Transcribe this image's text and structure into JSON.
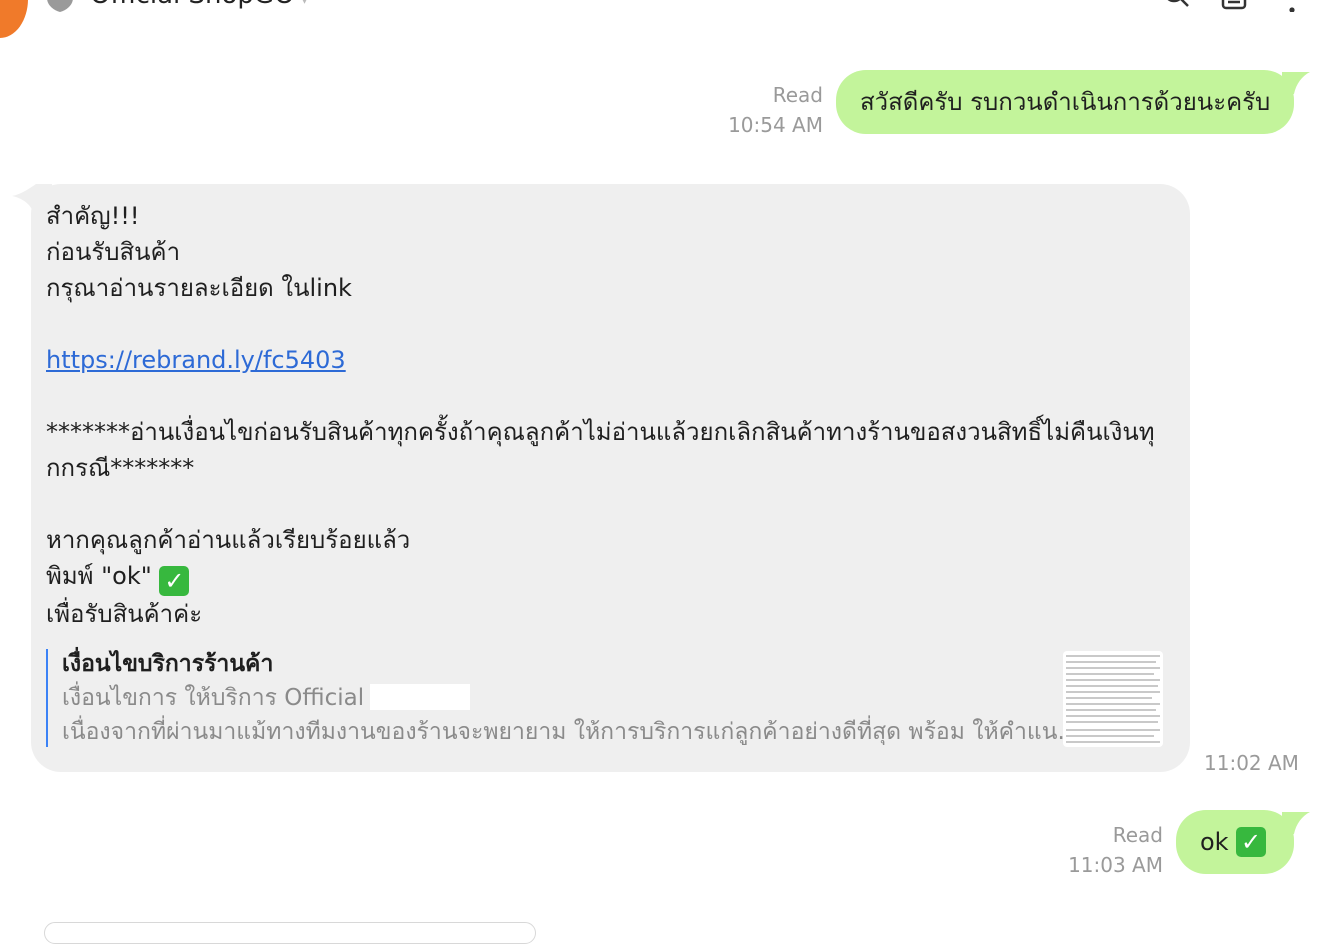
{
  "header": {
    "title": "Official ShopGO",
    "icons": [
      "shield-icon",
      "search-icon",
      "note-icon",
      "more-icon"
    ]
  },
  "messages": {
    "first_out": {
      "text": "สวัสดีครับ รบกวนดำเนินการด้วยนะครับ",
      "status": "Read",
      "time": "10:54 AM"
    },
    "incoming": {
      "lines": {
        "l1": "สำคัญ!!!",
        "l2": "ก่อนรับสินค้า",
        "l3": "กรุณาอ่านรายละเอียด ในlink",
        "link": "https://rebrand.ly/fc5403",
        "warning": "*******อ่านเงื่อนไขก่อนรับสินค้าทุกครั้งถ้าคุณลูกค้าไม่อ่านแล้วยกเลิกสินค้าทางร้านขอสงวนสิทธิ์ไม่คืนเงินทุกกรณี*******",
        "l5": "หากคุณลูกค้าอ่านแล้วเรียบร้อยแล้ว",
        "l6": "พิมพ์ \"ok\"",
        "l7": "เพื่อรับสินค้าค่ะ"
      },
      "check_glyph": "✓",
      "preview": {
        "title": "เงื่อนไขบริการร้านค้า",
        "subtitle": "เงื่อนไขการ ให้บริการ Official",
        "description": "เนื่องจากที่ผ่านมาแม้ทางทีมงานของร้านจะพยายาม ให้การบริการแก่ลูกค้าอย่างดีที่สุด พร้อม ให้คำแน..."
      },
      "time": "11:02 AM"
    },
    "second_out": {
      "text": "ok",
      "status": "Read",
      "time": "11:03 AM"
    }
  },
  "colors": {
    "outgoing_bubble": "#c3f49b",
    "incoming_bubble": "#efefef",
    "link": "#2d6ad6",
    "accent_orange": "#f07a2a",
    "check_green": "#37b83e"
  }
}
